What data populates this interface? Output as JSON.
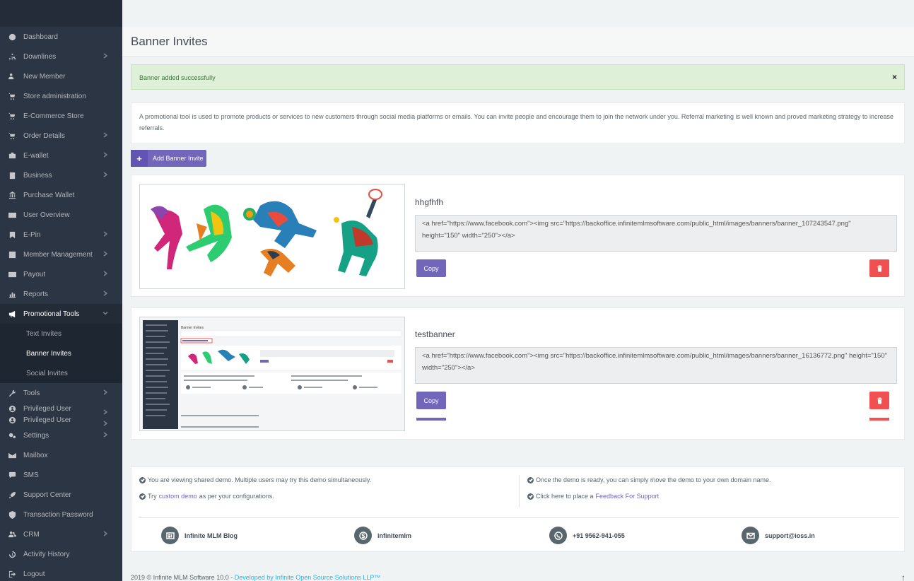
{
  "sidebar": {
    "items": [
      {
        "label": "Dashboard",
        "icon": "dashboard-icon",
        "chevron": false
      },
      {
        "label": "Downlines",
        "icon": "sitemap-icon",
        "chevron": true
      },
      {
        "label": "New Member",
        "icon": "user-plus-icon",
        "chevron": false
      },
      {
        "label": "Store administration",
        "icon": "cart-icon",
        "chevron": false
      },
      {
        "label": "E-Commerce Store",
        "icon": "cart-icon",
        "chevron": false
      },
      {
        "label": "Order Details",
        "icon": "cart-icon",
        "chevron": true
      },
      {
        "label": "E-wallet",
        "icon": "briefcase-icon",
        "chevron": true
      },
      {
        "label": "Business",
        "icon": "building-icon",
        "chevron": true
      },
      {
        "label": "Purchase Wallet",
        "icon": "bank-icon",
        "chevron": false
      },
      {
        "label": "User Overview",
        "icon": "id-card-icon",
        "chevron": false
      },
      {
        "label": "E-Pin",
        "icon": "bookmark-icon",
        "chevron": true
      },
      {
        "label": "Member Management",
        "icon": "user-square-icon",
        "chevron": true
      },
      {
        "label": "Payout",
        "icon": "money-icon",
        "chevron": true
      },
      {
        "label": "Reports",
        "icon": "bar-chart-icon",
        "chevron": true
      },
      {
        "label": "Promotional Tools",
        "icon": "bullhorn-icon",
        "chevron": true,
        "active": true
      }
    ],
    "promo_sub": [
      "Text Invites",
      "Banner Invites",
      "Social Invites"
    ],
    "items_after": [
      {
        "label": "Tools",
        "icon": "wrench-icon",
        "chevron": true
      },
      {
        "label": "Privileged User",
        "icon": "user-circle-icon",
        "chevron": true,
        "compact": true
      },
      {
        "label": "Privileged User",
        "icon": "user-circle-icon",
        "chevron": true,
        "compact": true
      },
      {
        "label": "Settings",
        "icon": "cogs-icon",
        "chevron": true
      },
      {
        "label": "Mailbox",
        "icon": "envelope-icon",
        "chevron": false
      },
      {
        "label": "SMS",
        "icon": "comment-icon",
        "chevron": false
      },
      {
        "label": "Support Center",
        "icon": "rocket-icon",
        "chevron": false
      },
      {
        "label": "Transaction Password",
        "icon": "shield-icon",
        "chevron": false
      },
      {
        "label": "CRM",
        "icon": "users-icon",
        "chevron": true
      },
      {
        "label": "Activity History",
        "icon": "history-icon",
        "chevron": false
      },
      {
        "label": "Logout",
        "icon": "logout-icon",
        "chevron": false
      }
    ]
  },
  "page": {
    "title": "Banner Invites",
    "alert": "Banner added successfully",
    "alert_close": "×",
    "description": "A promotional tool is used to promote products or services to new customers through social media platforms or emails. You can invite people and encourage them to join the network under you. Referral marketing is well known and proved marketing strategy to increase referrals.",
    "add_button": "Add Banner Invite",
    "add_plus": "+",
    "copy_label": "Copy"
  },
  "banners": [
    {
      "name": "hhgfhfh",
      "code": "<a href=\"https://www.facebook.com\"><img src=\"https://backoffice.infinitemlmsoftware.com/public_html/images/banners/banner_107243547.png\" height=\"150\" width=\"250\"></a>"
    },
    {
      "name": "testbanner",
      "code": "<a href=\"https://www.facebook.com\"><img src=\"https://backoffice.infinitemlmsoftware.com/public_html/images/banners/banner_16136772.png\" height=\"150\" width=\"250\"></a>"
    }
  ],
  "info": {
    "left1": "You are viewing shared demo. Multiple users may try this demo simultaneously.",
    "left2_pre": "Try",
    "left2_link": "custom demo",
    "left2_post": "as per your configurations.",
    "right1": "Once the demo is ready, you can simply move the demo to your own domain name.",
    "right2_pre": "Click here to place a",
    "right2_link": "Feedback For Support",
    "contacts": [
      {
        "label": "Infinite MLM Blog",
        "icon": "blog-icon"
      },
      {
        "label": "infinitemlm",
        "icon": "skype-icon"
      },
      {
        "label": "+91 9562-941-055",
        "icon": "whatsapp-icon"
      },
      {
        "label": "support@ioss.in",
        "icon": "envelope-icon"
      }
    ]
  },
  "footer": {
    "copyright": "2019 © Infinite MLM Software 10.0 -",
    "developer": "Developed by Infinite Open Source Solutions LLP™",
    "up_arrow": "↑"
  }
}
